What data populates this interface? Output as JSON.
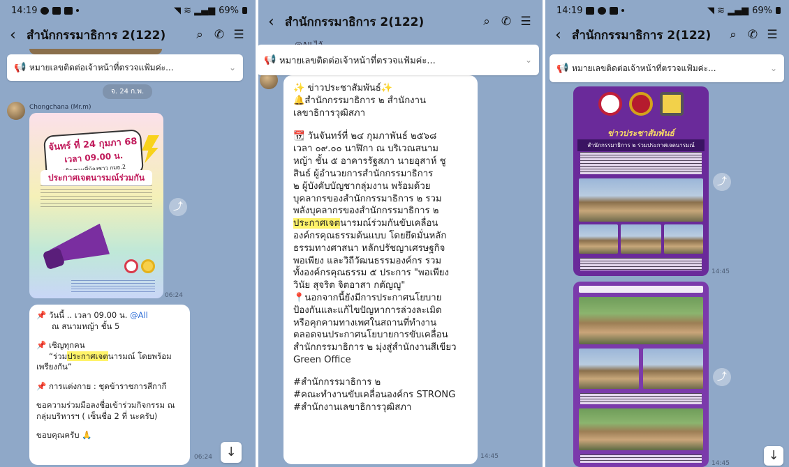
{
  "panel1": {
    "status": {
      "time": "14:19",
      "battery": "69%"
    },
    "header": {
      "title": "สำนักกรรมาธิการ 2(122)"
    },
    "announcement": "หมายเลขติดต่อเจ้าหน้าที่ตรวจแฟ้มค่ะ...",
    "date_pill": "จ. 24 ก.พ.",
    "sender": "Chongchana (Mr.m)",
    "poster": {
      "date_line": "จันทร์ ที่ 24 กุมภา 68",
      "time_line": "เวลา 09.00 น.",
      "invite_line": "เชิญชวนพี่น้องชาว กมธ.2",
      "headline": "ประกาศเจตนารมณ์ร่วมกัน"
    },
    "poster_time": "06:24",
    "message": {
      "line1_prefix": "📌 วันนี้ .. เวลา 09.00 น. ",
      "line1_mention": "@All",
      "line2": "ณ สนามหญ้า ชั้น 5",
      "line3": "📌 เชิญทุกคน",
      "line4_pre": "“ร่วม",
      "line4_hl": "ประกาศเจต",
      "line4_post": "นารมณ์ โดยพร้อม",
      "line5": "เพรียงกัน”",
      "line6": "📌 การแต่งกาย : ชุดข้าราชการสีกากี",
      "line7": "ขอความร่วมมือลงชื่อเข้าร่วมกิจกรรม ณ",
      "line8": "กลุ่มบริหารฯ ( เซ็นชื่อ 2 ที่ นะครับ)",
      "line9": "ขอบคุณครับ 🙏"
    },
    "message_time": "06:24"
  },
  "panel2": {
    "header": {
      "title": "สำนักกรรมาธิการ 2(122)"
    },
    "top_partial": "@All ไอ้ ... ... ...",
    "announcement": "หมายเลขติดต่อเจ้าหน้าที่ตรวจแฟ้มค่ะ...",
    "message": {
      "l1": "✨ ข่าวประชาสัมพันธ์✨",
      "l2": "🔔สำนักกรรมาธิการ ๒ สำนักงาน",
      "l3": "เลขาธิการวุฒิสภา",
      "l4": "📆 วันจันทร์ที่ ๒๔ กุมภาพันธ์ ๒๕๖๘",
      "l5": "เวลา ๐๙.๐๐ นาฬิกา ณ บริเวณสนาม",
      "l6": "หญ้า ชั้น ๕ อาคารรัฐสภา นายอุสาห์ ชู",
      "l7": "สินธ์ ผู้อำนวยการสำนักกรรมาธิการ",
      "l8": "๒ ผู้บังคับบัญชากลุ่มงาน พร้อมด้วย",
      "l9": "บุคลากรของสำนักกรรมาธิการ ๒ รวม",
      "l10": "พลังบุคลากรของสำนักกรรมาธิการ ๒",
      "l11_hl": "ประกาศเจต",
      "l11_post": "นารมณ์ร่วมกันขับเคลื่อน",
      "l12": "องค์กรคุณธรรมต้นแบบ โดยยึดมั่นหลัก",
      "l13": "ธรรมทางศาสนา หลักปรัชญาเศรษฐกิจ",
      "l14": "พอเพียง และวิถีวัฒนธรรมองค์กร รวม",
      "l15": "ทั้งองค์กรคุณธรรม ๕ ประการ \"พอเพียง",
      "l16": "วินัย สุจริต จิตอาสา กตัญญู\"",
      "l17": "📍นอกจากนี้ยังมีการประกาศนโยบาย",
      "l18": "ป้องกันและแก้ไขปัญหาการล่วงละเมิด",
      "l19": "หรือคุกคามทางเพศในสถานที่ทำงาน",
      "l20": "ตลอดจนประกาศนโยบายการขับเคลื่อน",
      "l21": "สำนักกรรมาธิการ ๒ มุ่งสู่สำนักงานสีเขียว",
      "l22": "Green Office",
      "l23": "#สำนักกรรมาธิการ ๒",
      "l24": "#คณะทำงานขับเคลื่อนองค์กร STRONG",
      "l25": "#สำนักงานเลขาธิการวุฒิสภา"
    },
    "message_time": "14:45"
  },
  "panel3": {
    "status": {
      "time": "14:19",
      "battery": "69%"
    },
    "header": {
      "title": "สำนักกรรมาธิการ 2(122)"
    },
    "announcement": "หมายเลขติดต่อเจ้าหน้าที่ตรวจแฟ้มค่ะ...",
    "card1": {
      "title": "ข่าวประชาสัมพันธ์",
      "subtitle": "สำนักกรรมาธิการ ๒ ร่วมประกาศเจตนารมณ์"
    },
    "card1_time": "14:45",
    "card2_time": "14:45"
  },
  "colors": {
    "chat_bg": "#8fa8c8",
    "highlight": "#fff36a",
    "mention": "#2b6bd6",
    "poster_purple": "#6a2a9a"
  },
  "icons": [
    "back-arrow-icon",
    "search-icon",
    "phone-icon",
    "menu-icon",
    "megaphone-icon",
    "chevron-down-icon",
    "share-icon",
    "arrow-down-icon"
  ]
}
